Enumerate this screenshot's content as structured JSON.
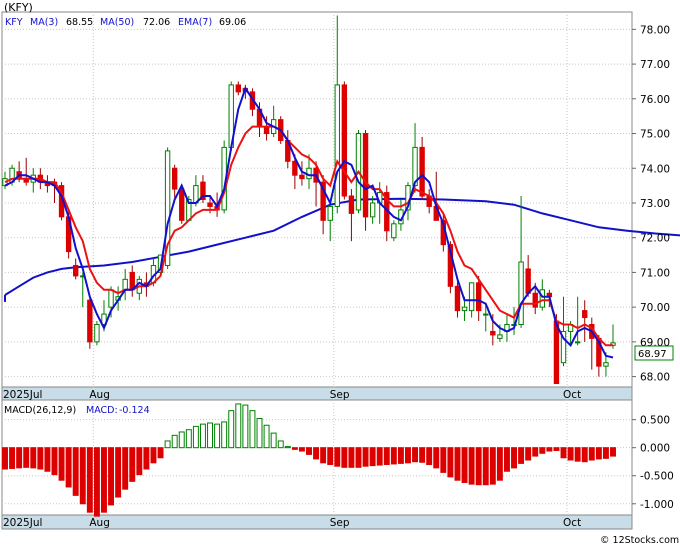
{
  "ticker_label": "(KFY)",
  "legend": {
    "ticker": "KFY",
    "ma3": "MA(3)",
    "ma3_value": "68.55",
    "ma50": "MA(50)",
    "ma50_value": "72.06",
    "ema7": "EMA(7)",
    "ema7_value": "69.06"
  },
  "last_price_tag": "68.97",
  "macd_legend": {
    "title": "MACD(26,12,9)",
    "label": "MACD:",
    "value": "-0.124"
  },
  "watermark": "© 12Stocks.com",
  "colors": {
    "bull": "#008000",
    "bear": "#dd0000",
    "ma50": "#1111cc",
    "ema7": "#ee1111",
    "ma3": "#1111cc",
    "axis_band": "#c8dde8"
  },
  "chart_data": [
    {
      "type": "candlestick",
      "y_tick_labels": [
        "68.00",
        "69.00",
        "70.00",
        "71.00",
        "72.00",
        "73.00",
        "74.00",
        "75.00",
        "76.00",
        "77.00",
        "78.00"
      ],
      "ylim": [
        67.7,
        78.5
      ],
      "x_month_labels": [
        {
          "label": "2025Jul",
          "index": 0
        },
        {
          "label": "Aug",
          "index": 13
        },
        {
          "label": "Sep",
          "index": 47
        },
        {
          "label": "Oct",
          "index": 80
        }
      ],
      "ohlc": [
        [
          73.5,
          73.9,
          73.4,
          73.7
        ],
        [
          73.6,
          74.1,
          73.5,
          74.0
        ],
        [
          73.9,
          74.2,
          73.6,
          73.7
        ],
        [
          73.7,
          74.3,
          73.5,
          73.6
        ],
        [
          73.6,
          74.0,
          73.3,
          73.8
        ],
        [
          73.8,
          74.0,
          73.4,
          73.6
        ],
        [
          73.6,
          73.8,
          73.3,
          73.5
        ],
        [
          73.6,
          73.7,
          73.0,
          73.5
        ],
        [
          73.5,
          73.6,
          72.5,
          72.6
        ],
        [
          72.6,
          72.8,
          71.4,
          71.6
        ],
        [
          71.2,
          71.4,
          70.8,
          70.9
        ],
        [
          70.9,
          71.0,
          70.0,
          70.9
        ],
        [
          70.2,
          70.3,
          68.8,
          69.0
        ],
        [
          69.0,
          69.6,
          68.9,
          69.5
        ],
        [
          69.5,
          70.2,
          69.3,
          69.8
        ],
        [
          70.0,
          70.6,
          69.7,
          70.5
        ],
        [
          70.2,
          70.6,
          69.9,
          70.3
        ],
        [
          70.5,
          71.1,
          70.2,
          70.8
        ],
        [
          71.0,
          71.2,
          70.3,
          70.5
        ],
        [
          70.4,
          70.9,
          70.2,
          70.8
        ],
        [
          70.7,
          71.0,
          70.3,
          70.6
        ],
        [
          70.7,
          71.4,
          70.6,
          71.2
        ],
        [
          71.0,
          71.5,
          70.9,
          71.5
        ],
        [
          71.2,
          74.6,
          71.1,
          74.5
        ],
        [
          74.0,
          74.1,
          73.1,
          73.4
        ],
        [
          73.4,
          73.5,
          72.4,
          72.5
        ],
        [
          72.5,
          73.2,
          72.5,
          73.1
        ],
        [
          73.0,
          73.8,
          72.9,
          73.5
        ],
        [
          73.6,
          73.8,
          73.0,
          73.1
        ],
        [
          73.0,
          73.2,
          72.7,
          72.9
        ],
        [
          72.9,
          73.3,
          72.6,
          72.8
        ],
        [
          72.8,
          74.8,
          72.7,
          74.6
        ],
        [
          74.6,
          76.5,
          74.5,
          76.4
        ],
        [
          76.4,
          76.5,
          76.1,
          76.2
        ],
        [
          76.3,
          76.4,
          76.0,
          76.2
        ],
        [
          76.2,
          76.3,
          75.5,
          75.7
        ],
        [
          75.7,
          75.9,
          74.9,
          75.2
        ],
        [
          75.2,
          75.5,
          74.8,
          75.0
        ],
        [
          75.0,
          75.8,
          74.9,
          75.4
        ],
        [
          75.4,
          75.5,
          74.7,
          74.8
        ],
        [
          74.8,
          75.1,
          74.0,
          74.2
        ],
        [
          74.2,
          74.4,
          73.4,
          73.8
        ],
        [
          73.8,
          74.2,
          73.5,
          73.7
        ],
        [
          73.7,
          74.4,
          73.4,
          74.0
        ],
        [
          74.0,
          74.2,
          72.9,
          73.6
        ],
        [
          73.6,
          73.8,
          72.1,
          72.5
        ],
        [
          72.5,
          72.9,
          71.9,
          72.9
        ],
        [
          72.9,
          78.4,
          72.7,
          76.4
        ],
        [
          76.4,
          76.5,
          73.1,
          73.2
        ],
        [
          73.2,
          73.4,
          71.9,
          72.7
        ],
        [
          72.8,
          75.1,
          72.7,
          75.0
        ],
        [
          75.0,
          75.1,
          72.2,
          72.6
        ],
        [
          72.6,
          73.2,
          72.4,
          73.0
        ],
        [
          73.0,
          73.6,
          72.4,
          73.3
        ],
        [
          73.3,
          73.5,
          71.9,
          72.2
        ],
        [
          72.0,
          72.5,
          71.9,
          72.4
        ],
        [
          72.4,
          73.1,
          72.2,
          72.8
        ],
        [
          72.8,
          73.6,
          72.5,
          73.5
        ],
        [
          73.5,
          75.3,
          73.3,
          74.6
        ],
        [
          74.6,
          74.9,
          73.1,
          73.2
        ],
        [
          73.2,
          73.4,
          72.7,
          72.9
        ],
        [
          72.9,
          73.9,
          72.5,
          72.5
        ],
        [
          72.5,
          72.7,
          71.6,
          71.8
        ],
        [
          71.8,
          71.9,
          70.4,
          70.6
        ],
        [
          70.6,
          70.8,
          69.7,
          69.9
        ],
        [
          69.9,
          70.3,
          69.6,
          70.0
        ],
        [
          69.9,
          70.7,
          69.7,
          70.7
        ],
        [
          70.7,
          70.9,
          69.6,
          69.9
        ],
        [
          69.8,
          70.1,
          69.3,
          69.8
        ],
        [
          69.3,
          69.8,
          68.9,
          69.2
        ],
        [
          69.1,
          69.5,
          69.0,
          69.2
        ],
        [
          69.3,
          69.8,
          69.0,
          69.5
        ],
        [
          69.5,
          70.0,
          69.2,
          69.5
        ],
        [
          69.5,
          73.2,
          69.4,
          71.3
        ],
        [
          71.1,
          71.5,
          70.3,
          70.4
        ],
        [
          70.4,
          70.7,
          69.8,
          70.0
        ],
        [
          70.0,
          70.8,
          69.9,
          70.5
        ],
        [
          70.4,
          70.5,
          70.0,
          70.3
        ],
        [
          69.6,
          69.8,
          67.8,
          67.8
        ],
        [
          68.4,
          70.3,
          68.3,
          69.3
        ],
        [
          69.3,
          69.6,
          68.9,
          69.5
        ],
        [
          69.0,
          70.3,
          68.9,
          69.0
        ],
        [
          69.9,
          70.2,
          69.0,
          69.7
        ],
        [
          69.5,
          69.7,
          68.2,
          69.1
        ],
        [
          69.1,
          69.2,
          68.0,
          68.3
        ],
        [
          68.3,
          68.7,
          68.0,
          68.4
        ],
        [
          68.9,
          69.5,
          68.8,
          68.97
        ]
      ],
      "ema7": [
        73.6,
        73.7,
        73.7,
        73.7,
        73.7,
        73.7,
        73.6,
        73.6,
        73.3,
        72.8,
        72.3,
        71.9,
        71.1,
        70.7,
        70.5,
        70.5,
        70.4,
        70.5,
        70.5,
        70.6,
        70.6,
        70.7,
        70.9,
        71.8,
        72.2,
        72.3,
        72.5,
        72.7,
        72.8,
        72.8,
        72.8,
        73.3,
        74.1,
        74.6,
        75.0,
        75.2,
        75.2,
        75.2,
        75.2,
        75.1,
        74.8,
        74.6,
        74.4,
        74.3,
        74.1,
        73.7,
        73.5,
        74.2,
        73.9,
        73.6,
        73.9,
        73.6,
        73.4,
        73.4,
        73.1,
        72.9,
        72.9,
        73.0,
        73.4,
        73.3,
        73.2,
        73.0,
        72.7,
        72.2,
        71.6,
        71.2,
        71.1,
        70.8,
        70.5,
        70.2,
        69.9,
        69.8,
        69.7,
        70.1,
        70.1,
        70.1,
        70.2,
        70.2,
        69.6,
        69.5,
        69.5,
        69.4,
        69.5,
        69.4,
        69.1,
        68.9,
        68.9
      ],
      "ma3": [
        73.5,
        73.6,
        73.8,
        73.8,
        73.7,
        73.6,
        73.6,
        73.5,
        73.2,
        72.6,
        71.7,
        71.1,
        70.3,
        69.8,
        69.4,
        69.9,
        70.2,
        70.5,
        70.5,
        70.7,
        70.6,
        70.9,
        71.1,
        72.4,
        73.1,
        73.5,
        73.0,
        73.0,
        73.2,
        73.2,
        72.9,
        73.4,
        74.6,
        75.7,
        76.3,
        76.0,
        75.7,
        75.3,
        75.2,
        75.1,
        74.8,
        74.3,
        73.9,
        73.8,
        73.8,
        73.4,
        73.0,
        73.9,
        74.2,
        74.1,
        73.6,
        73.4,
        73.5,
        73.0,
        72.8,
        72.6,
        72.5,
        72.9,
        73.6,
        73.8,
        73.6,
        72.9,
        72.4,
        71.6,
        70.8,
        70.2,
        70.2,
        70.2,
        70.1,
        69.6,
        69.4,
        69.3,
        69.4,
        70.1,
        70.4,
        70.6,
        70.3,
        70.3,
        69.5,
        69.1,
        68.9,
        69.3,
        69.4,
        69.3,
        69.0,
        68.6,
        68.55
      ],
      "ma50": [
        null,
        null,
        null,
        null,
        null,
        null,
        null,
        null,
        null,
        null,
        70.35,
        70.55,
        70.75,
        70.9,
        71.0,
        71.05,
        71.1,
        71.15,
        71.2,
        71.22,
        71.25,
        71.3,
        71.38,
        71.45,
        71.55,
        71.65,
        71.75,
        71.85,
        71.95,
        72.05,
        72.12,
        72.2,
        72.35,
        72.5,
        72.62,
        72.75,
        72.85,
        72.95,
        73.02,
        73.08,
        73.1,
        73.12,
        73.12,
        73.12,
        73.12,
        73.12,
        73.1,
        73.1,
        73.08,
        73.08,
        73.08,
        73.06,
        73.05,
        73.05,
        73.04,
        73.03,
        73.03,
        73.02,
        73.02,
        73.0,
        72.98,
        72.95,
        72.9,
        72.85,
        72.78,
        72.72,
        72.68,
        72.62,
        72.56,
        72.5,
        72.45,
        72.4,
        72.35,
        72.3,
        72.25,
        72.22,
        72.2,
        72.18,
        72.18,
        72.18,
        72.17,
        72.16,
        72.14,
        72.12,
        72.1,
        72.08,
        72.06
      ],
      "ma50_pre": [
        [
          -1,
          70.35
        ],
        [
          -0.5,
          70.35
        ]
      ],
      "ma50_points": [
        [
          0,
          70.35
        ],
        [
          2,
          70.6
        ],
        [
          4,
          70.85
        ],
        [
          6,
          71.0
        ],
        [
          8,
          71.1
        ],
        [
          10,
          71.15
        ],
        [
          14,
          71.2
        ],
        [
          18,
          71.3
        ],
        [
          22,
          71.45
        ],
        [
          26,
          71.6
        ],
        [
          30,
          71.8
        ],
        [
          34,
          72.0
        ],
        [
          38,
          72.2
        ],
        [
          42,
          72.6
        ],
        [
          46,
          72.95
        ],
        [
          50,
          73.1
        ],
        [
          56,
          73.12
        ],
        [
          62,
          73.1
        ],
        [
          68,
          73.05
        ],
        [
          72,
          72.95
        ],
        [
          76,
          72.7
        ],
        [
          80,
          72.5
        ],
        [
          84,
          72.3
        ],
        [
          88,
          72.2
        ],
        [
          92,
          72.12
        ],
        [
          96,
          72.06
        ]
      ]
    },
    {
      "type": "bar",
      "title": "MACD(26,12,9)",
      "y_tick_labels": [
        "0.500",
        "0.000",
        "-0.500",
        "-1.000"
      ],
      "ylim": [
        -1.2,
        0.85
      ],
      "values": [
        -0.38,
        -0.37,
        -0.36,
        -0.35,
        -0.36,
        -0.38,
        -0.42,
        -0.48,
        -0.58,
        -0.7,
        -0.85,
        -1.0,
        -1.15,
        -1.22,
        -1.15,
        -1.02,
        -0.88,
        -0.74,
        -0.6,
        -0.48,
        -0.38,
        -0.27,
        -0.18,
        0.12,
        0.22,
        0.28,
        0.32,
        0.38,
        0.42,
        0.44,
        0.42,
        0.46,
        0.66,
        0.78,
        0.76,
        0.66,
        0.52,
        0.4,
        0.26,
        0.12,
        0.02,
        -0.03,
        -0.06,
        -0.12,
        -0.2,
        -0.27,
        -0.3,
        -0.33,
        -0.35,
        -0.35,
        -0.35,
        -0.33,
        -0.32,
        -0.31,
        -0.3,
        -0.29,
        -0.28,
        -0.27,
        -0.25,
        -0.26,
        -0.3,
        -0.36,
        -0.44,
        -0.52,
        -0.58,
        -0.62,
        -0.65,
        -0.66,
        -0.66,
        -0.65,
        -0.58,
        -0.42,
        -0.36,
        -0.28,
        -0.22,
        -0.15,
        -0.1,
        -0.06,
        -0.05,
        -0.18,
        -0.22,
        -0.24,
        -0.25,
        -0.22,
        -0.2,
        -0.19,
        -0.15
      ]
    }
  ]
}
